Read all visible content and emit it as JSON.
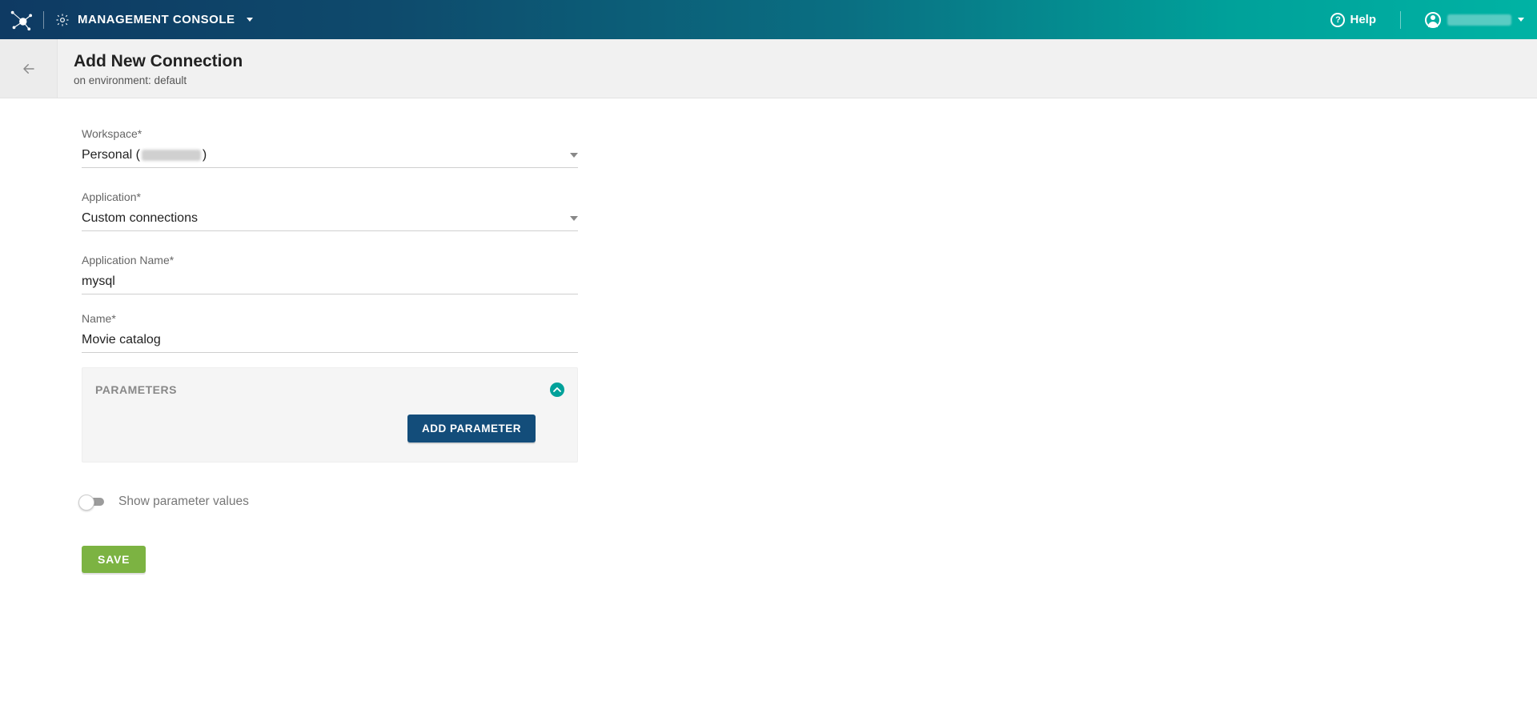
{
  "nav": {
    "app_label": "MANAGEMENT CONSOLE",
    "help_label": "Help"
  },
  "page": {
    "title": "Add New Connection",
    "subtitle": "on environment: default"
  },
  "form": {
    "workspace": {
      "label": "Workspace*",
      "value_prefix": "Personal (",
      "value_suffix": ")"
    },
    "application": {
      "label": "Application*",
      "value": "Custom connections"
    },
    "application_name": {
      "label": "Application Name*",
      "value": "mysql"
    },
    "name": {
      "label": "Name*",
      "value": "Movie catalog"
    },
    "parameters": {
      "title": "PARAMETERS",
      "add_button": "ADD PARAMETER"
    },
    "show_values_toggle": {
      "label": "Show parameter values",
      "on": false
    },
    "save_button": "SAVE"
  }
}
